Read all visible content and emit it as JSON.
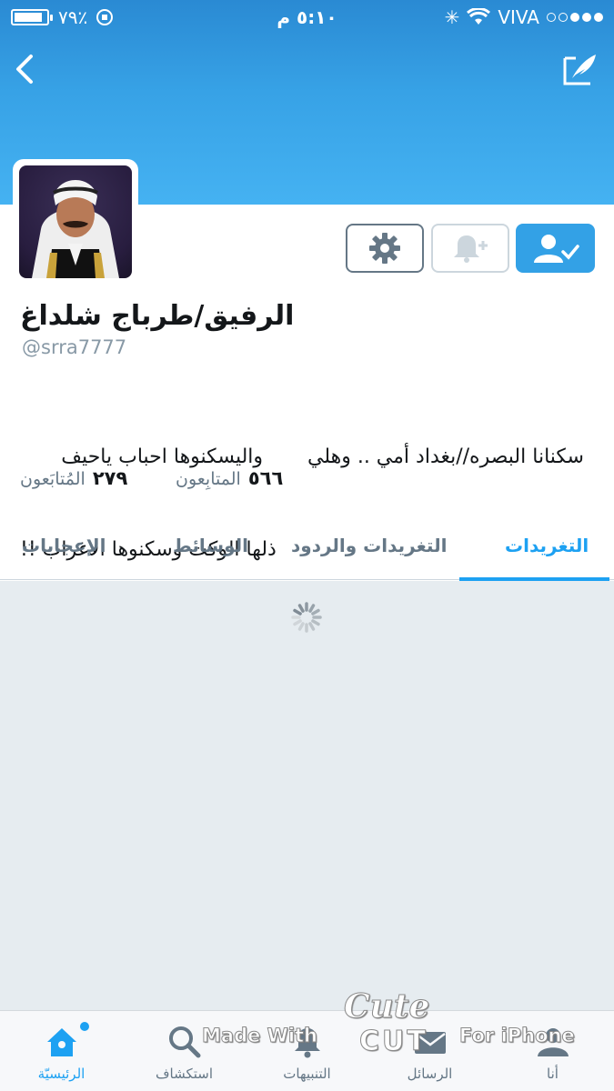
{
  "status_bar": {
    "battery_percent": "٧٩٪",
    "time": "٥:١٠ م",
    "carrier": "VIVA"
  },
  "profile": {
    "display_name": "الرفيق/طرباج شلداغ",
    "handle": "@srra7777",
    "bio_line1": "سكنانا البصره//بغداد أمي .. وهلي       واليسكنوها احباب ياحيف",
    "bio_line2": "ذلها الوكت وسكنوها الاغراب !!",
    "followers_count": "٥٦٦",
    "followers_label": "المتابِعون",
    "following_count": "٢٧٩",
    "following_label": "المُتابَعون"
  },
  "tabs": [
    {
      "label": "التغريدات",
      "active": true
    },
    {
      "label": "التغريدات والردود",
      "active": false
    },
    {
      "label": "الوسائط",
      "active": false
    },
    {
      "label": "الإعجابات",
      "active": false
    }
  ],
  "tabbar": [
    {
      "label": "الرئيسيّة",
      "icon": "home-icon",
      "active": true
    },
    {
      "label": "استكشاف",
      "icon": "search-icon",
      "active": false
    },
    {
      "label": "التنبيهات",
      "icon": "bell-icon",
      "active": false
    },
    {
      "label": "الرسائل",
      "icon": "envelope-icon",
      "active": false
    },
    {
      "label": "أنا",
      "icon": "person-icon",
      "active": false
    }
  ],
  "watermark": {
    "cute": "Cute",
    "made_with": "Made With",
    "cut": "CUT",
    "for_iphone": "For iPhone"
  },
  "colors": {
    "accent": "#1da1f2",
    "banner": "#37a2e6",
    "content_bg": "#e6ecf0"
  }
}
